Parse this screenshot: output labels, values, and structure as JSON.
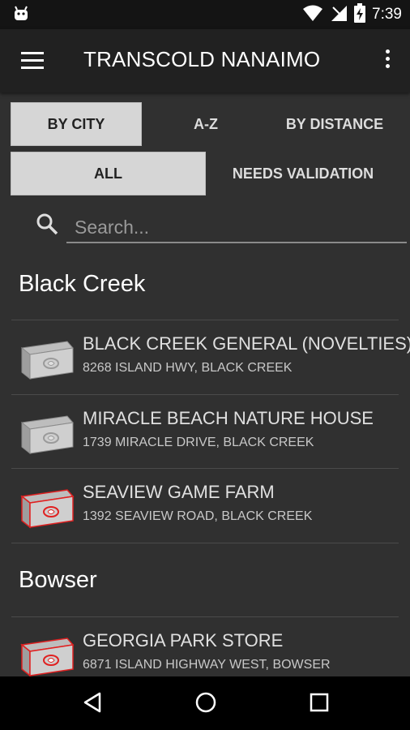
{
  "status_bar": {
    "time": "7:39"
  },
  "app_bar": {
    "title": "TRANSCOLD NANAIMO"
  },
  "sort_tabs": [
    {
      "label": "BY CITY",
      "selected": true
    },
    {
      "label": "A-Z",
      "selected": false
    },
    {
      "label": "BY DISTANCE",
      "selected": false
    }
  ],
  "filter_tabs": [
    {
      "label": "ALL",
      "selected": true
    },
    {
      "label": "NEEDS VALIDATION",
      "selected": false
    }
  ],
  "search": {
    "placeholder": "Search..."
  },
  "sections": [
    {
      "city": "Black Creek",
      "items": [
        {
          "name": "BLACK CREEK GENERAL (NOVELTIES)",
          "address": "8268  ISLAND HWY, BLACK CREEK",
          "status": "validated",
          "icon": "grey-freezer-icon"
        },
        {
          "name": "MIRACLE BEACH NATURE HOUSE",
          "address": "1739  MIRACLE DRIVE, BLACK CREEK",
          "status": "validated",
          "icon": "grey-freezer-icon"
        },
        {
          "name": "SEAVIEW GAME FARM",
          "address": "1392  SEAVIEW ROAD, BLACK CREEK",
          "status": "needs-validation",
          "icon": "red-freezer-icon"
        }
      ]
    },
    {
      "city": "Bowser",
      "items": [
        {
          "name": "GEORGIA PARK STORE",
          "address": "6871  ISLAND HIGHWAY WEST, BOWSER",
          "status": "needs-validation",
          "icon": "red-freezer-icon"
        }
      ]
    }
  ],
  "colors": {
    "background": "#303030",
    "app_bar": "#212121",
    "selected_tab": "#d6d6d6",
    "alert_red": "#e02020"
  }
}
